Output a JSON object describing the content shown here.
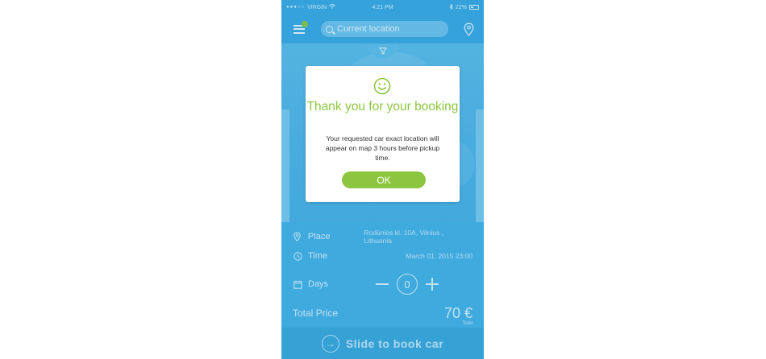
{
  "status_bar": {
    "signal": "●●●○○",
    "carrier": "VIRGIN",
    "time": "4:21 PM",
    "battery": "22%"
  },
  "header": {
    "search_placeholder": "Current location",
    "menu_icon": "hamburger-menu-icon",
    "location_icon": "map-pin-icon"
  },
  "details": {
    "place": {
      "label": "Place",
      "value": "Rodūnios kl. 10A, Vilnius , Lithuania"
    },
    "time": {
      "label": "Time",
      "value": "March 01, 2015     23:00"
    },
    "days": {
      "label": "Days",
      "count": "0"
    }
  },
  "total": {
    "label": "Total Price",
    "price": "70 €",
    "sub": "Total"
  },
  "slider": {
    "label": "Slide to book car",
    "arrow": "→"
  },
  "modal": {
    "icon": "smiley-icon",
    "title": "Thank you for your booking",
    "message": "Your requested car exact location will appear on map 3 hours before pickup time.",
    "ok_label": "OK"
  },
  "colors": {
    "primary_blue": "#45b1e6",
    "accent_green": "#8cc63f"
  }
}
